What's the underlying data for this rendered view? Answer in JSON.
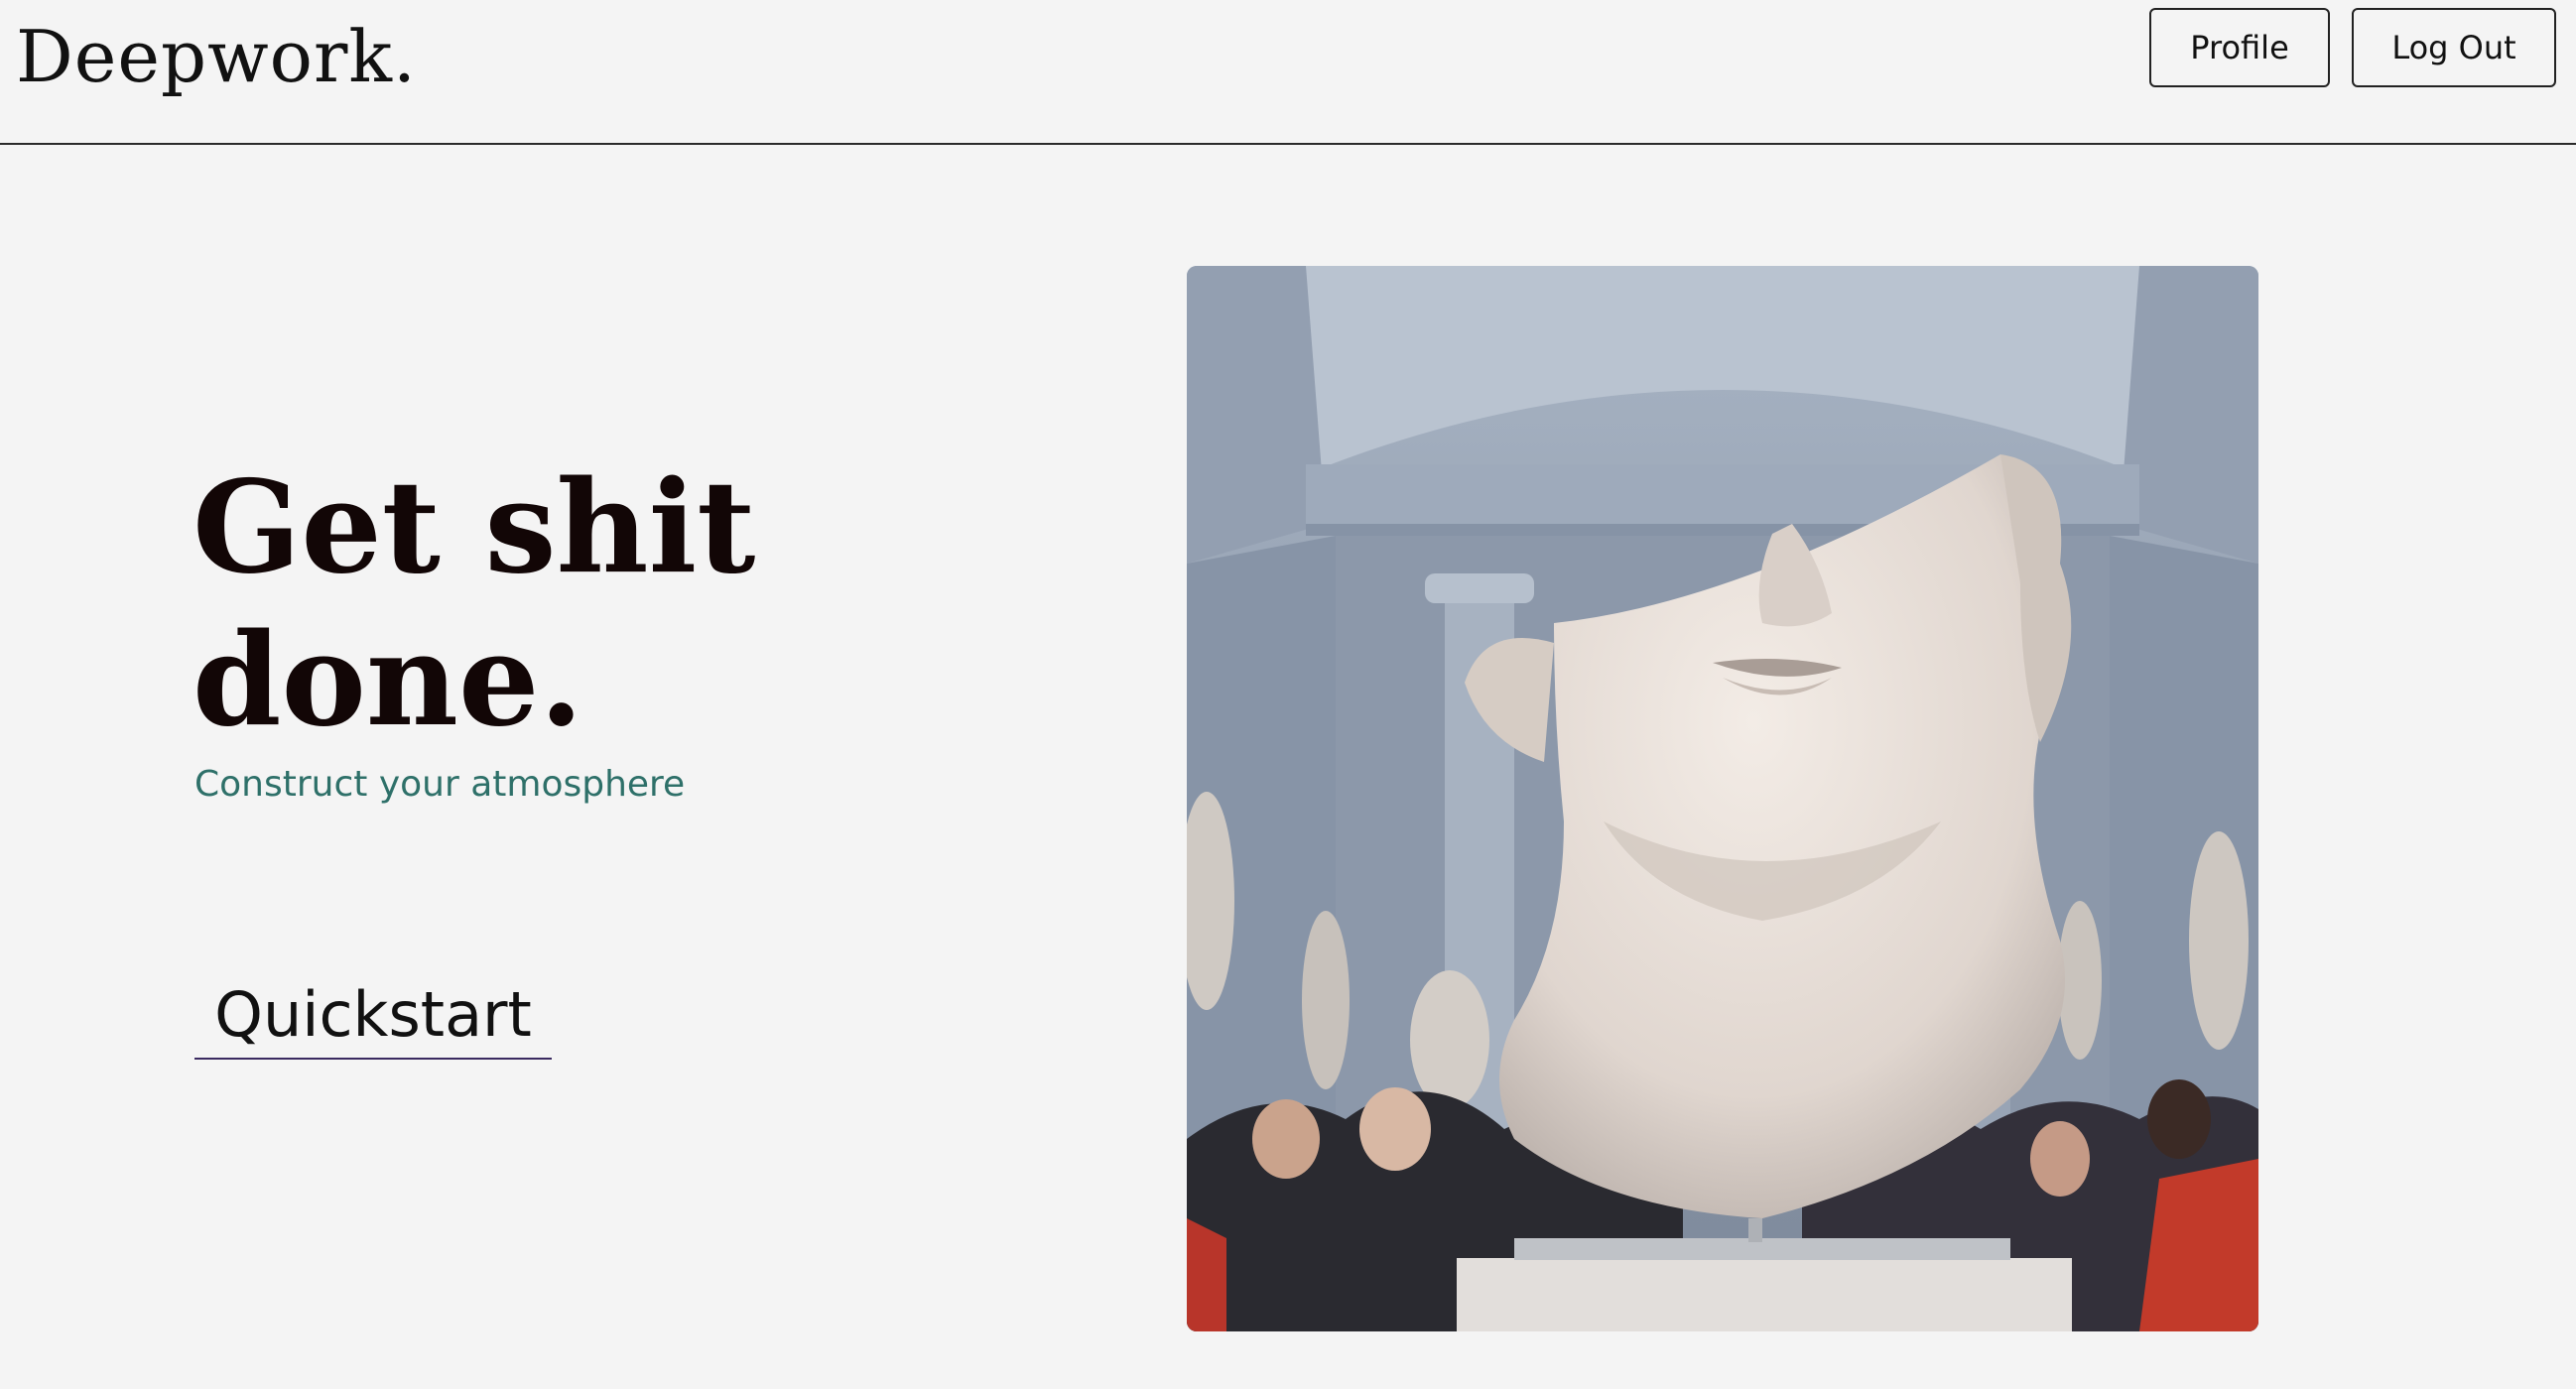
{
  "header": {
    "logo": "Deepwork.",
    "profile_label": "Profile",
    "logout_label": "Log Out"
  },
  "hero": {
    "title": "Get shit done.",
    "subtitle": "Construct your atmosphere",
    "quickstart_label": "Quickstart",
    "image_subject": "marble-bust-museum-photo"
  },
  "colors": {
    "background": "#f4f4f4",
    "subtitle": "#2e7069",
    "quickstart_underline": "#3a2a60",
    "title": "#120606"
  }
}
